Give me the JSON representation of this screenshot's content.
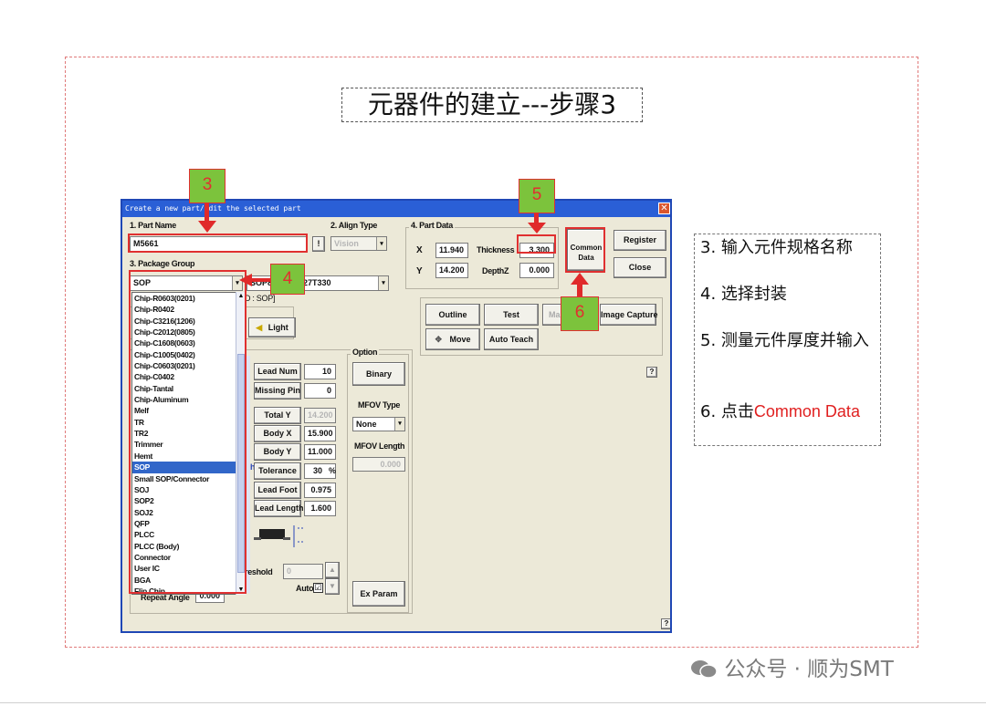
{
  "slide": {
    "title": "元器件的建立---步骤3"
  },
  "dialog": {
    "title": "Create a new part/Edit the selected part",
    "close_glyph": "✕",
    "part_name_label": "1. Part Name",
    "part_name_value": "M5661",
    "excl_label": "!",
    "align_type_label": "2. Align Type",
    "align_type_value": "Vision",
    "package_group_label": "3. Package Group",
    "package_group_value": "SOP",
    "package_type_value": "SOP8",
    "package_name_tail": "127T330",
    "cad_label": "D : SOP]",
    "part_data_label": "4. Part Data",
    "x_label": "X",
    "x_value": "11.940",
    "y_label": "Y",
    "y_value": "14.200",
    "thickness_label": "Thickness",
    "thickness_value": "3.300",
    "depthz_label": "DepthZ",
    "depthz_value": "0.000",
    "common_data_line1": "Common",
    "common_data_line2": "Data",
    "register_label": "Register",
    "close_label": "Close",
    "outline_label": "Outline",
    "test_label": "Test",
    "make_label": "Ma",
    "image_capture_label": "Image Capture",
    "move_label": "Move",
    "auto_teach_label": "Auto Teach",
    "light_label": "Light",
    "option_label": "Option",
    "lead_num_label": "Lead Num",
    "lead_num_value": "10",
    "missing_pin_label": "Missing Pin",
    "missing_pin_value": "0",
    "total_y_label": "Total Y",
    "total_y_value": "14.200",
    "body_x_label": "Body X",
    "body_x_value": "15.900",
    "body_y_label": "Body Y",
    "body_y_value": "11.000",
    "tolerance_label": "Tolerance",
    "tolerance_value": "30",
    "tolerance_unit": "%",
    "lead_foot_label": "Lead Foot",
    "lead_foot_value": "0.975",
    "lead_length_label": "Lead Length",
    "lead_length_value": "1.600",
    "binary_label": "Binary",
    "mfov_type_label": "MFOV Type",
    "mfov_type_value": "None",
    "mfov_length_label": "MFOV Length",
    "mfov_length_value": "0.000",
    "threshold_label": "reshold",
    "threshold_value": "0",
    "auto_label": "Auto",
    "auto_checked": "☑",
    "repeat_angle_label": "Repeat Angle",
    "repeat_angle_value": "0.000",
    "ex_param_label": "Ex Param",
    "help_glyph": "?",
    "h_glyph": "h",
    "package_list": [
      "Chip-R0603(0201)",
      "Chip-R0402",
      "Chip-C3216(1206)",
      "Chip-C2012(0805)",
      "Chip-C1608(0603)",
      "Chip-C1005(0402)",
      "Chip-C0603(0201)",
      "Chip-C0402",
      "Chip-Tantal",
      "Chip-Aluminum",
      "Melf",
      "TR",
      "TR2",
      "Trimmer",
      "Hemt",
      "SOP",
      "Small SOP/Connector",
      "SOJ",
      "SOP2",
      "SOJ2",
      "QFP",
      "PLCC",
      "PLCC (Body)",
      "Connector",
      "User IC",
      "BGA",
      "Flip Chip"
    ],
    "package_list_selected": "SOP"
  },
  "callouts": {
    "c3": "3",
    "c4": "4",
    "c5": "5",
    "c6": "6"
  },
  "steps": {
    "s3": "3. 输入元件规格名称",
    "s4": "4. 选择封装",
    "s5": "5. 测量元件厚度并输入",
    "s6_prefix": "6. 点击",
    "s6_red": "Common Data"
  },
  "watermark": "公众号 · 顺为SMT",
  "colors": {
    "title_bar": "#2a5fd6",
    "selection": "#3166c9",
    "callout_red": "#e03030",
    "callout_green": "#7cc33c"
  }
}
